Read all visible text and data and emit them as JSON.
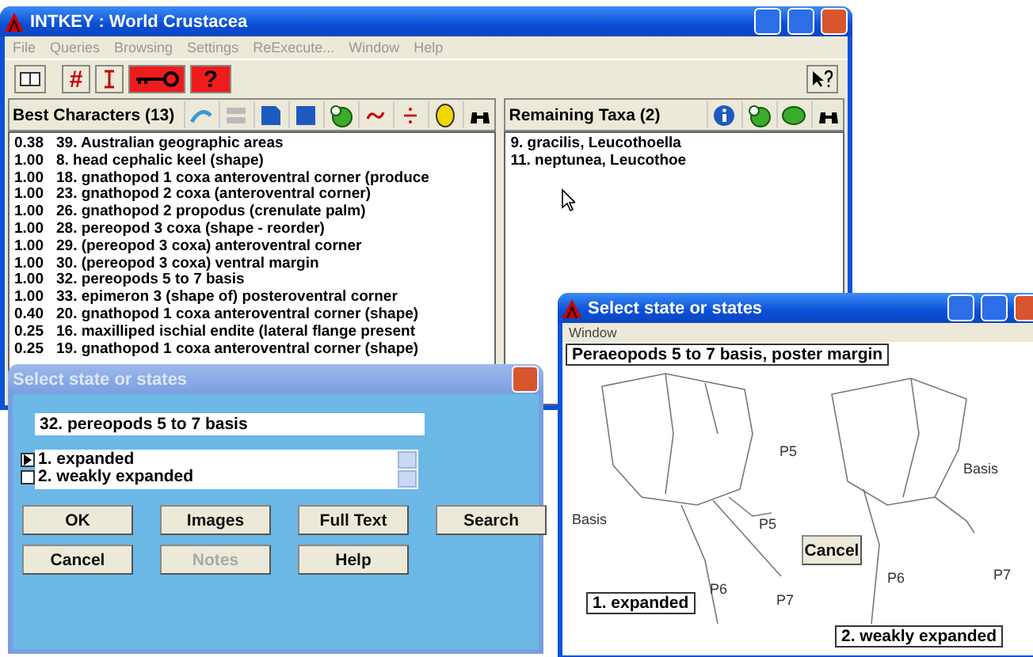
{
  "main_window": {
    "title": "INTKEY : World Crustacea",
    "menu": [
      "File",
      "Queries",
      "Browsing",
      "Settings",
      "ReExecute...",
      "Window",
      "Help"
    ],
    "toolbar_glyphs": [
      "#",
      "?"
    ],
    "best_characters": {
      "title": "Best Characters (13)",
      "rows": [
        {
          "score": "0.38",
          "label": "39. Australian geographic areas"
        },
        {
          "score": "1.00",
          "label": "8. head cephalic keel (shape)"
        },
        {
          "score": "1.00",
          "label": "18. gnathopod 1 coxa anteroventral corner (produce"
        },
        {
          "score": "1.00",
          "label": "23. gnathopod 2 coxa (anteroventral corner)"
        },
        {
          "score": "1.00",
          "label": "26. gnathopod 2 propodus (crenulate palm)"
        },
        {
          "score": "1.00",
          "label": "28. pereopod 3 coxa (shape - reorder)"
        },
        {
          "score": "1.00",
          "label": "29. (pereopod 3 coxa) anteroventral corner"
        },
        {
          "score": "1.00",
          "label": "30. (pereopod 3 coxa) ventral margin"
        },
        {
          "score": "1.00",
          "label": "32. pereopods 5 to 7 basis"
        },
        {
          "score": "1.00",
          "label": "33. epimeron 3 (shape of) posteroventral corner"
        },
        {
          "score": "0.40",
          "label": "20. gnathopod 1 coxa anteroventral corner (shape)"
        },
        {
          "score": "0.25",
          "label": "16. maxilliped ischial endite (lateral flange present"
        },
        {
          "score": "0.25",
          "label": "19. gnathopod 1 coxa anteroventral corner (shape)"
        }
      ]
    },
    "remaining_taxa": {
      "title": "Remaining Taxa (2)",
      "rows": [
        "9. gracilis, Leucothoella",
        "11. neptunea, Leucothoe"
      ]
    }
  },
  "state_dialog": {
    "title": "Select state or states",
    "character": "32. pereopods 5 to 7 basis",
    "states": [
      {
        "label": "1. expanded",
        "selected": true
      },
      {
        "label": "2. weakly expanded",
        "selected": false
      }
    ],
    "buttons": [
      {
        "label": "OK",
        "disabled": false
      },
      {
        "label": "Images",
        "disabled": false
      },
      {
        "label": "Full Text",
        "disabled": false
      },
      {
        "label": "Search",
        "disabled": false
      },
      {
        "label": "Cancel",
        "disabled": false
      },
      {
        "label": "Notes",
        "disabled": true
      },
      {
        "label": "Help",
        "disabled": false
      }
    ]
  },
  "image_window": {
    "title": "Select state or states",
    "menu": [
      "Window"
    ],
    "caption": "Peraeopods 5 to 7 basis, poster margin",
    "cancel": "Cancel",
    "figures": [
      {
        "caption": "1. expanded",
        "labels": [
          "Basis",
          "P5",
          "P6",
          "P7"
        ]
      },
      {
        "caption": "2. weakly expanded",
        "labels": [
          "P5",
          "Basis",
          "P6",
          "P7"
        ]
      }
    ]
  }
}
